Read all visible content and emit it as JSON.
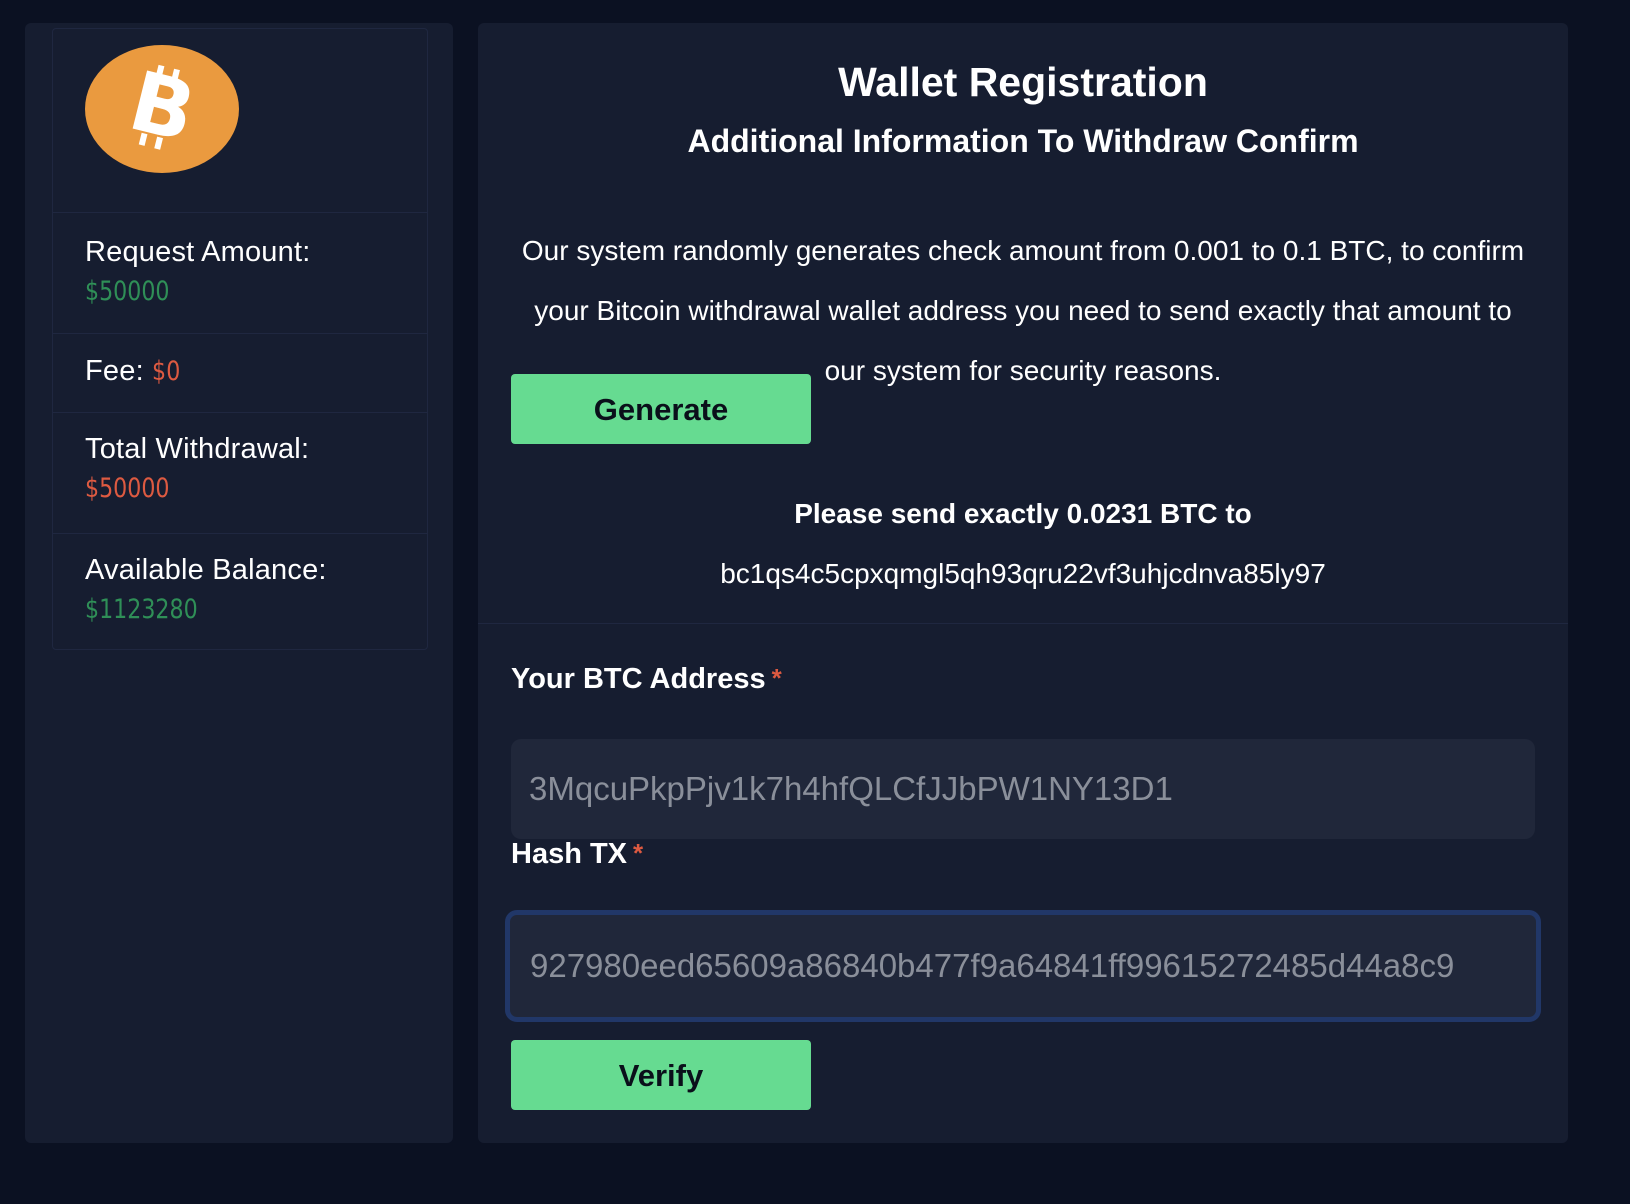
{
  "sidebar": {
    "logo_icon": "bitcoin-logo-icon",
    "logo_color": "#ea9a3f",
    "request_amount_label": "Request Amount:",
    "request_amount_value": "$50000",
    "fee_label": "Fee:",
    "fee_value": "$0",
    "total_withdrawal_label": "Total Withdrawal:",
    "total_withdrawal_value": "$50000",
    "available_balance_label": "Available Balance:",
    "available_balance_value": "$1123280"
  },
  "main": {
    "title": "Wallet Registration",
    "subtitle": "Additional Information To Withdraw Confirm",
    "description": "Our system randomly generates check amount from 0.001 to 0.1 BTC, to confirm your Bitcoin withdrawal wallet address you need to send exactly that amount to our system for security reasons.",
    "generate_label": "Generate",
    "send_instruction": "Please send exactly 0.0231 BTC  to",
    "send_address": "bc1qs4c5cpxqmgl5qh93qru22vf3uhjcdnva85ly97",
    "btc_address_label": "Your BTC Address",
    "btc_address_value": "3MqcuPkpPjv1k7h4hfQLCfJJbPW1NY13D1",
    "hash_tx_label": "Hash TX",
    "hash_tx_value": "927980eed65609a86840b477f9a64841ff99615272485d44a8c9",
    "required_marker": "*",
    "verify_label": "Verify"
  },
  "colors": {
    "background": "#0b1122",
    "panel": "#161d30",
    "accent_button": "#66db91",
    "positive_value": "#2f8f57",
    "negative_value": "#dd5a41",
    "focus_border": "#213768"
  }
}
